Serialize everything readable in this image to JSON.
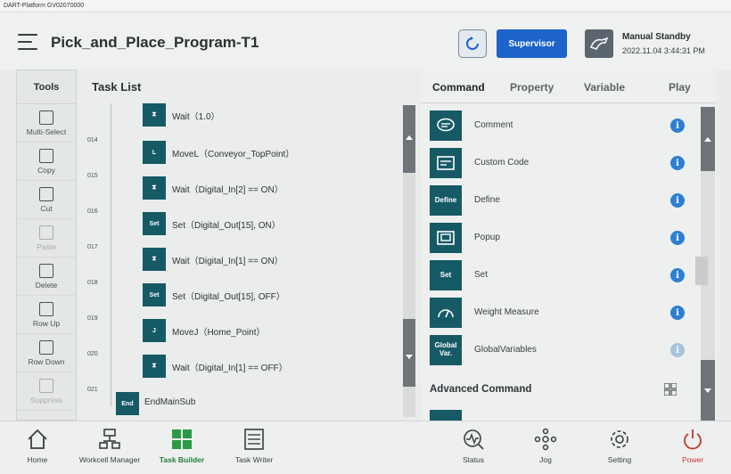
{
  "window": {
    "title": "DART-Platform GV02070000"
  },
  "header": {
    "program_title": "Pick_and_Place_Program-T1",
    "refresh_icon": "refresh-icon",
    "supervisor_label": "Supervisor",
    "status_title": "Manual Standby",
    "status_time": "2022.11.04 3:44:31 PM"
  },
  "tools": {
    "title": "Tools",
    "items": [
      {
        "label": "Multi-Select",
        "icon": "multi-select-icon",
        "enabled": true
      },
      {
        "label": "Copy",
        "icon": "copy-icon",
        "enabled": true
      },
      {
        "label": "Cut",
        "icon": "cut-icon",
        "enabled": true
      },
      {
        "label": "Paste",
        "icon": "paste-icon",
        "enabled": false
      },
      {
        "label": "Delete",
        "icon": "delete-icon",
        "enabled": true
      },
      {
        "label": "Row Up",
        "icon": "row-up-icon",
        "enabled": true
      },
      {
        "label": "Row Down",
        "icon": "row-down-icon",
        "enabled": true
      },
      {
        "label": "Suppress",
        "icon": "suppress-icon",
        "enabled": false
      }
    ]
  },
  "tasklist": {
    "title": "Task List",
    "rows": [
      {
        "num": "",
        "icon": "wait-icon",
        "icon_text": "⧗",
        "text": "Wait（1.0）"
      },
      {
        "num": "014",
        "icon": "movel-icon",
        "icon_text": "L",
        "text": "MoveL（Conveyor_TopPoint）"
      },
      {
        "num": "015",
        "icon": "wait-icon",
        "icon_text": "⧗",
        "text": "Wait（Digital_In[2] == ON）"
      },
      {
        "num": "016",
        "icon": "set-icon",
        "icon_text": "Set",
        "text": "Set（Digital_Out[15], ON）"
      },
      {
        "num": "017",
        "icon": "wait-icon",
        "icon_text": "⧗",
        "text": "Wait（Digital_In[1] == ON）"
      },
      {
        "num": "018",
        "icon": "set-icon",
        "icon_text": "Set",
        "text": "Set（Digital_Out[15], OFF）"
      },
      {
        "num": "019",
        "icon": "movej-icon",
        "icon_text": "J",
        "text": "MoveJ（Home_Point）"
      },
      {
        "num": "020",
        "icon": "wait-icon",
        "icon_text": "⧗",
        "text": "Wait（Digital_In[1] == OFF）"
      },
      {
        "num": "021",
        "icon": "end-icon",
        "icon_text": "End",
        "text": "EndMainSub"
      }
    ]
  },
  "panel": {
    "tabs": [
      "Command",
      "Property",
      "Variable",
      "Play"
    ],
    "active_tab": "Command",
    "commands": [
      {
        "label": "Comment",
        "icon": "comment-icon",
        "icon_text": ""
      },
      {
        "label": "Custom Code",
        "icon": "custom-code-icon",
        "icon_text": ""
      },
      {
        "label": "Define",
        "icon": "define-icon",
        "icon_text": "Define"
      },
      {
        "label": "Popup",
        "icon": "popup-icon",
        "icon_text": ""
      },
      {
        "label": "Set",
        "icon": "set-icon",
        "icon_text": "Set"
      },
      {
        "label": "Weight Measure",
        "icon": "weight-measure-icon",
        "icon_text": ""
      },
      {
        "label": "GlobalVariables",
        "icon": "global-var-icon",
        "icon_text": "Global Var."
      }
    ],
    "advanced_title": "Advanced Command"
  },
  "bottom_nav": [
    {
      "label": "Home",
      "icon": "home-icon"
    },
    {
      "label": "Workcell Manager",
      "icon": "workcell-icon"
    },
    {
      "label": "Task Builder",
      "icon": "task-builder-icon"
    },
    {
      "label": "Task Writer",
      "icon": "task-writer-icon"
    },
    {
      "label": "Status",
      "icon": "status-icon"
    },
    {
      "label": "Jog",
      "icon": "jog-icon"
    },
    {
      "label": "Setting",
      "icon": "gear-icon"
    },
    {
      "label": "Power",
      "icon": "power-icon"
    }
  ],
  "colors": {
    "accent_blue": "#1d63c9",
    "icon_teal": "#165a66",
    "active_green": "#24803a",
    "power_red": "#c7332b"
  }
}
